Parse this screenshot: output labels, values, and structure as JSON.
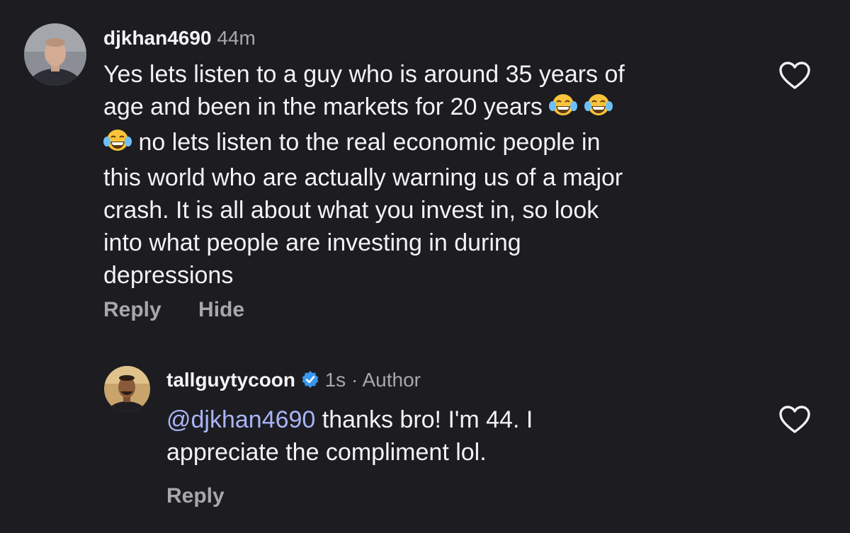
{
  "comments": [
    {
      "username": "djkhan4690",
      "time": "44m",
      "lines": [
        "Yes lets listen to a guy who is around 35 years of",
        "age and been in the markets for 20 years",
        "no lets listen to the real economic people in",
        "this world who are actually warning us of a major",
        "crash. It is all about what you invest in, so look",
        "into what people are investing in during",
        "depressions"
      ],
      "emoji": "face-with-tears-of-joy",
      "actions": {
        "reply": "Reply",
        "hide": "Hide"
      },
      "liked": false
    },
    {
      "username": "tallguytycoon",
      "verified": true,
      "time": "1s",
      "separator": "·",
      "role": "Author",
      "mention": "@djkhan4690",
      "line1_rest": " thanks bro! I'm 44. I",
      "line2": "appreciate the compliment lol.",
      "actions": {
        "reply": "Reply"
      },
      "liked": false
    }
  ],
  "colors": {
    "background": "#1c1c21",
    "text": "#f3f3f3",
    "muted": "#a8a8ac",
    "mention": "#a9b4f5",
    "verified": "#3897f0"
  }
}
